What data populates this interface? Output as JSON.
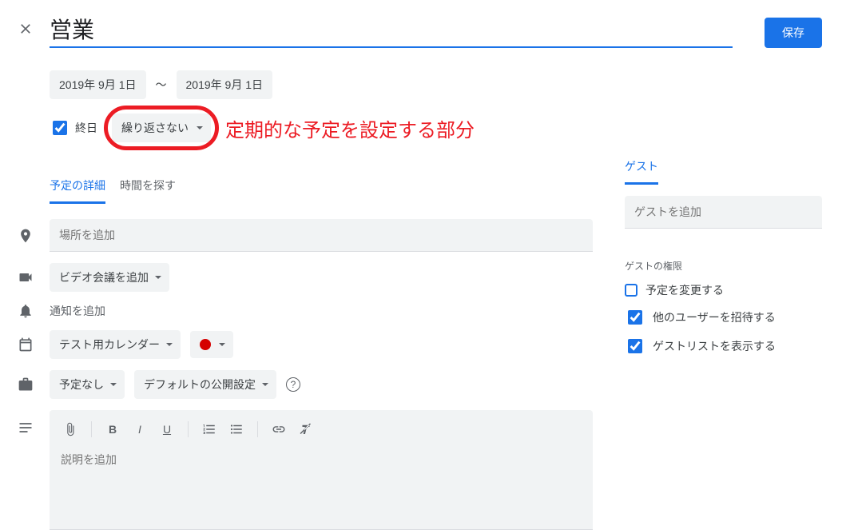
{
  "header": {
    "title_value": "営業",
    "save_label": "保存"
  },
  "dates": {
    "start": "2019年 9月 1日",
    "separator": "〜",
    "end": "2019年 9月 1日"
  },
  "allday": {
    "label": "終日",
    "checked": true
  },
  "recurrence": {
    "label": "繰り返さない"
  },
  "annotation": {
    "text": "定期的な予定を設定する部分"
  },
  "tabs": {
    "details": "予定の詳細",
    "find_time": "時間を探す"
  },
  "location": {
    "placeholder": "場所を追加"
  },
  "video": {
    "label": "ビデオ会議を追加"
  },
  "notification": {
    "label": "通知を追加"
  },
  "calendar": {
    "name": "テスト用カレンダー",
    "color": "#d50000"
  },
  "availability": {
    "busy": "予定なし",
    "visibility": "デフォルトの公開設定"
  },
  "description": {
    "placeholder": "説明を追加"
  },
  "guests": {
    "tab": "ゲスト",
    "placeholder": "ゲストを追加",
    "permissions_heading": "ゲストの権限",
    "perm_modify": "予定を変更する",
    "perm_invite": "他のユーザーを招待する",
    "perm_see": "ゲストリストを表示する"
  }
}
